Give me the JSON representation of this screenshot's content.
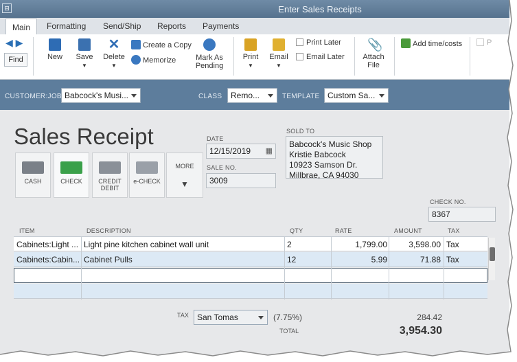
{
  "window": {
    "title": "Enter Sales Receipts"
  },
  "tabs": [
    {
      "label": "Main",
      "active": true
    },
    {
      "label": "Formatting"
    },
    {
      "label": "Send/Ship"
    },
    {
      "label": "Reports"
    },
    {
      "label": "Payments"
    }
  ],
  "toolbar": {
    "find": "Find",
    "new": "New",
    "save": "Save",
    "delete": "Delete",
    "create_copy": "Create a Copy",
    "memorize": "Memorize",
    "mark_pending": "Mark As Pending",
    "print": "Print",
    "email": "Email",
    "print_later": "Print Later",
    "email_later": "Email Later",
    "attach_file": "Attach File",
    "add_time_costs": "Add time/costs",
    "partial": "P"
  },
  "customer_bar": {
    "customer_job_label": "CUSTOMER:JOB",
    "customer_job_value": "Babcock's Musi...",
    "class_label": "CLASS",
    "class_value": "Remo...",
    "template_label": "TEMPLATE",
    "template_value": "Custom Sa..."
  },
  "form": {
    "title": "Sales Receipt",
    "payment_methods": [
      {
        "label": "CASH"
      },
      {
        "label": "CHECK"
      },
      {
        "label": "CREDIT DEBIT"
      },
      {
        "label": "e-CHECK"
      }
    ],
    "more_label": "MORE",
    "date_label": "DATE",
    "date_value": "12/15/2019",
    "sale_no_label": "SALE NO.",
    "sale_no_value": "3009",
    "sold_to_label": "SOLD TO",
    "sold_to_lines": [
      "Babcock's Music Shop",
      "Kristie Babcock",
      "10923 Samson Dr.",
      "Millbrae, CA 94030"
    ],
    "check_no_label": "CHECK NO.",
    "check_no_value": "8367"
  },
  "items_table": {
    "headers": [
      "ITEM",
      "DESCRIPTION",
      "QTY",
      "RATE",
      "AMOUNT",
      "TAX"
    ],
    "rows": [
      {
        "item": "Cabinets:Light ...",
        "description": "Light pine kitchen cabinet wall unit",
        "qty": "2",
        "rate": "1,799.00",
        "amount": "3,598.00",
        "tax": "Tax"
      },
      {
        "item": "Cabinets:Cabin...",
        "description": "Cabinet Pulls",
        "qty": "12",
        "rate": "5.99",
        "amount": "71.88",
        "tax": "Tax"
      }
    ]
  },
  "totals": {
    "tax_label": "TAX",
    "tax_item": "San Tomas",
    "tax_rate": "(7.75%)",
    "tax_amount": "284.42",
    "total_label": "TOTAL",
    "total_amount": "3,954.30"
  },
  "colors": {
    "title_bar": "#5f7b97",
    "customer_bar": "#5d7d9c",
    "selected_row": "#dce9f5"
  }
}
